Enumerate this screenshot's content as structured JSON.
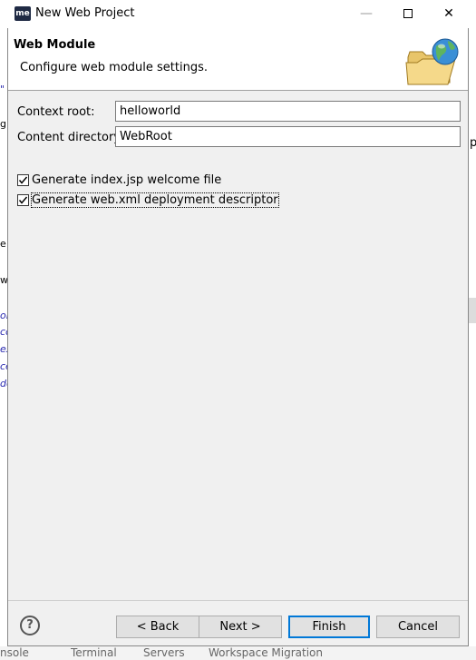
{
  "window": {
    "app_icon_text": "me",
    "title": "New Web Project",
    "minimize_icon": "minimize-icon",
    "maximize_icon": "maximize-icon",
    "close_icon": "close-icon"
  },
  "header": {
    "title": "Web Module",
    "description": "Configure web module settings.",
    "graphic_icon": "folder-globe-icon"
  },
  "form": {
    "context_root": {
      "label": "Context root:",
      "value": "helloworld"
    },
    "content_directory": {
      "label": "Content directory:",
      "value": "WebRoot"
    }
  },
  "options": [
    {
      "label": "Generate index.jsp welcome file",
      "checked": true
    },
    {
      "label": "Generate web.xml deployment descriptor",
      "checked": true
    }
  ],
  "buttons": {
    "help_label": "?",
    "back_label": "< Back",
    "next_label": "Next >",
    "finish_label": "Finish",
    "cancel_label": "Cancel"
  },
  "background": {
    "left_fragments": [
      "g",
      "e",
      "w",
      "on",
      "cc",
      "ex",
      "ce",
      "de"
    ],
    "right_fragment": "p",
    "bottom_tabs": [
      "nsole",
      "Terminal",
      "Servers",
      "Workspace Migration"
    ]
  },
  "colors": {
    "accent": "#0078d7",
    "dialog_bg": "#f0f0f0",
    "header_bg": "#ffffff"
  }
}
